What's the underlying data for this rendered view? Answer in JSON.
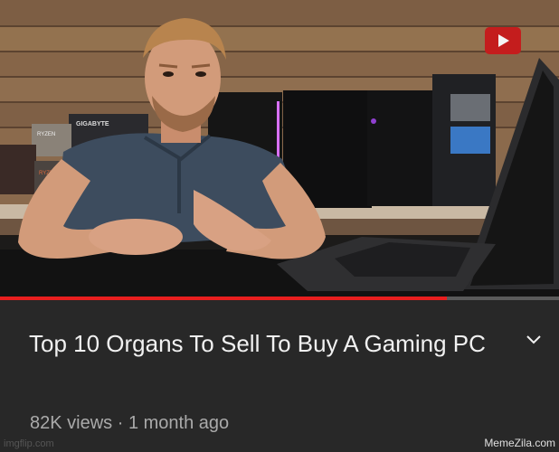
{
  "video": {
    "title": "Top 10 Organs To Sell To Buy A Gaming PC",
    "views": "82K views",
    "separator": "·",
    "age": "1 month ago",
    "progress_fraction": 0.8,
    "expand_icon": "chevron-down-icon"
  },
  "scene": {
    "box1_brand": "GIGABYTE",
    "box2_brand": "RYZEN",
    "box3_brand": "RYZEN"
  },
  "watermark": {
    "right": "MemeZila.com",
    "left": "imgflip.com"
  },
  "colors": {
    "background": "#282828",
    "title": "#f1f1f1",
    "meta": "#aaaaaa",
    "progress": "#e81e1e",
    "progress_track": "#5a5a5a"
  }
}
